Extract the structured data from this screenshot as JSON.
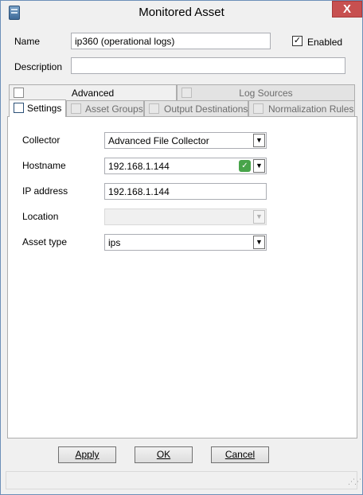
{
  "window": {
    "title": "Monitored Asset",
    "close_label": "X"
  },
  "form": {
    "name_label": "Name",
    "name_value": "ip360 (operational logs)",
    "enabled_label": "Enabled",
    "enabled_checked": true,
    "description_label": "Description",
    "description_value": ""
  },
  "tabs_row1": [
    {
      "label": "Advanced",
      "icon": "document-list-icon"
    },
    {
      "label": "Log Sources",
      "icon": "log-sources-icon"
    }
  ],
  "tabs_row2": [
    {
      "label": "Settings",
      "icon": "settings-icon",
      "active": true
    },
    {
      "label": "Asset Groups",
      "icon": "asset-groups-icon"
    },
    {
      "label": "Output Destinations",
      "icon": "output-destinations-icon"
    },
    {
      "label": "Normalization Rules",
      "icon": "normalization-rules-icon"
    }
  ],
  "settings": {
    "collector_label": "Collector",
    "collector_value": "Advanced File Collector",
    "hostname_label": "Hostname",
    "hostname_value": "192.168.1.144",
    "ip_label": "IP address",
    "ip_value": "192.168.1.144",
    "location_label": "Location",
    "location_value": "",
    "asset_type_label": "Asset type",
    "asset_type_value": "ips"
  },
  "buttons": {
    "apply": "Apply",
    "ok": "OK",
    "cancel": "Cancel"
  }
}
